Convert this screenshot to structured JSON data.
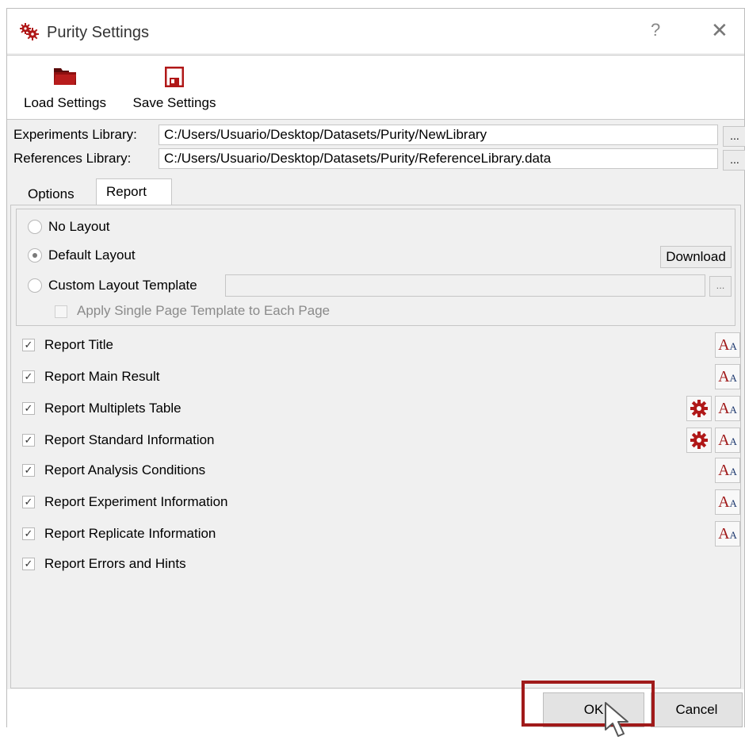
{
  "window": {
    "title": "Purity Settings",
    "help_glyph": "?",
    "close_glyph": "✕",
    "icon": "gears-icon"
  },
  "toolbar": {
    "load_label": "Load Settings",
    "save_label": "Save Settings",
    "load_icon": "folder-icon",
    "save_icon": "floppy-disk-icon"
  },
  "libraries": {
    "experiments_label": "Experiments Library:",
    "experiments_value": "C:/Users/Usuario/Desktop/Datasets/Purity/NewLibrary",
    "references_label": "References Library:",
    "references_value": "C:/Users/Usuario/Desktop/Datasets/Purity/ReferenceLibrary.data",
    "browse_label": "..."
  },
  "tabs": [
    {
      "label": "Options",
      "active": false
    },
    {
      "label": "Report",
      "active": true
    }
  ],
  "layout": {
    "no_layout": "No Layout",
    "default_layout": "Default Layout",
    "custom_layout": "Custom Layout Template",
    "selected": "Default Layout",
    "download_label": "Download",
    "template_value": "",
    "template_browse": "...",
    "apply_single_page": "Apply Single Page Template to Each Page"
  },
  "report_options": [
    {
      "label": "Report Title",
      "checked": true,
      "has_font": true,
      "has_gear": false
    },
    {
      "label": "Report Main Result",
      "checked": true,
      "has_font": true,
      "has_gear": false
    },
    {
      "label": "Report Multiplets Table",
      "checked": true,
      "has_font": true,
      "has_gear": true
    },
    {
      "label": "Report Standard Information",
      "checked": true,
      "has_font": true,
      "has_gear": true
    },
    {
      "label": "Report Analysis Conditions",
      "checked": true,
      "has_font": true,
      "has_gear": false
    },
    {
      "label": "Report Experiment Information",
      "checked": true,
      "has_font": true,
      "has_gear": false
    },
    {
      "label": "Report Replicate Information",
      "checked": true,
      "has_font": true,
      "has_gear": false
    },
    {
      "label": "Report Errors and Hints",
      "checked": true,
      "has_font": false,
      "has_gear": false
    }
  ],
  "font_button": {
    "big": "A",
    "small": "A"
  },
  "footer": {
    "ok_label": "OK",
    "cancel_label": "Cancel"
  },
  "colors": {
    "accent_red": "#a01a1a",
    "font_blue": "#1f3a70"
  }
}
